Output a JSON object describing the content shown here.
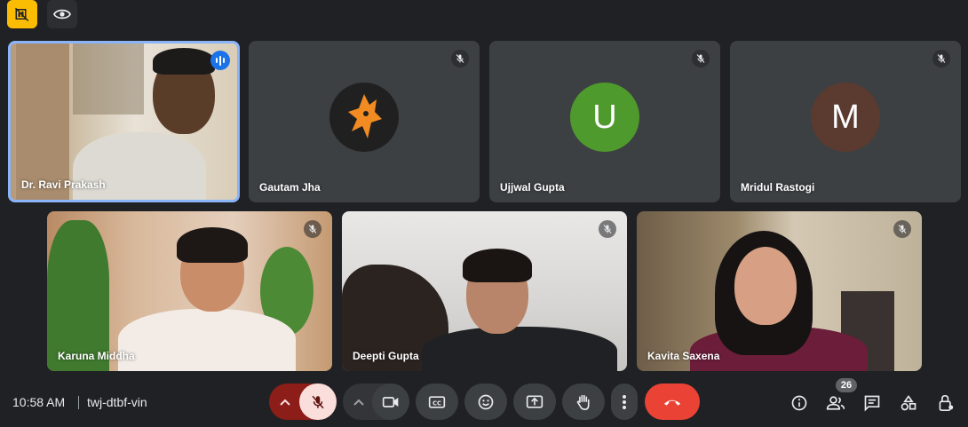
{
  "meeting": {
    "time": "10:58 AM",
    "code": "twj-dtbf-vin"
  },
  "top_controls": [
    {
      "icon": "hide-tiles-icon"
    },
    {
      "icon": "eye-icon"
    }
  ],
  "participants": [
    {
      "name": "Dr. Ravi Prakash",
      "speaking": true,
      "video": true
    },
    {
      "name": "Gautam Jha",
      "muted": true,
      "avatar": "logo"
    },
    {
      "name": "Ujjwal Gupta",
      "muted": true,
      "avatar_letter": "U",
      "avatar_color": "#4f9a2c"
    },
    {
      "name": "Mridul Rastogi",
      "muted": true,
      "avatar_letter": "M",
      "avatar_color": "#5b3a30"
    },
    {
      "name": "Karuna Middha",
      "muted": true,
      "video": true
    },
    {
      "name": "Deepti Gupta",
      "muted": true,
      "video": true
    },
    {
      "name": "Kavita Saxena",
      "muted": true,
      "video": true
    }
  ],
  "controls": {
    "mic_state": "muted",
    "people_count": "26",
    "leave_color": "#ea4335",
    "muted_color": "#f9dedc",
    "accent": "#8ab4f8"
  }
}
